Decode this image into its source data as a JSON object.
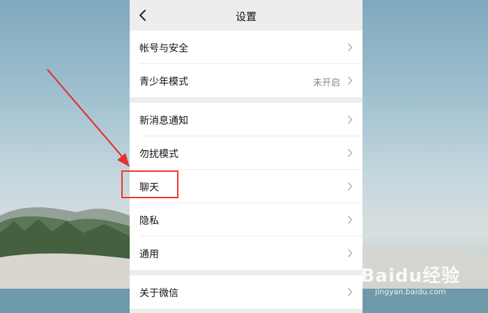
{
  "header": {
    "title": "设置",
    "back_icon": "chevron-left-icon"
  },
  "groups": [
    {
      "items": [
        {
          "label": "帐号与安全",
          "value": ""
        },
        {
          "label": "青少年模式",
          "value": "未开启"
        }
      ]
    },
    {
      "items": [
        {
          "label": "新消息通知",
          "value": ""
        },
        {
          "label": "勿扰模式",
          "value": ""
        },
        {
          "label": "聊天",
          "value": ""
        },
        {
          "label": "隐私",
          "value": ""
        },
        {
          "label": "通用",
          "value": ""
        }
      ]
    },
    {
      "items": [
        {
          "label": "关于微信",
          "value": ""
        }
      ]
    }
  ],
  "annotation": {
    "highlight_color": "#e33333",
    "highlighted_item": "聊天"
  },
  "watermark": {
    "main": "Baidu经验",
    "sub": "jingyan.baidu.com"
  }
}
